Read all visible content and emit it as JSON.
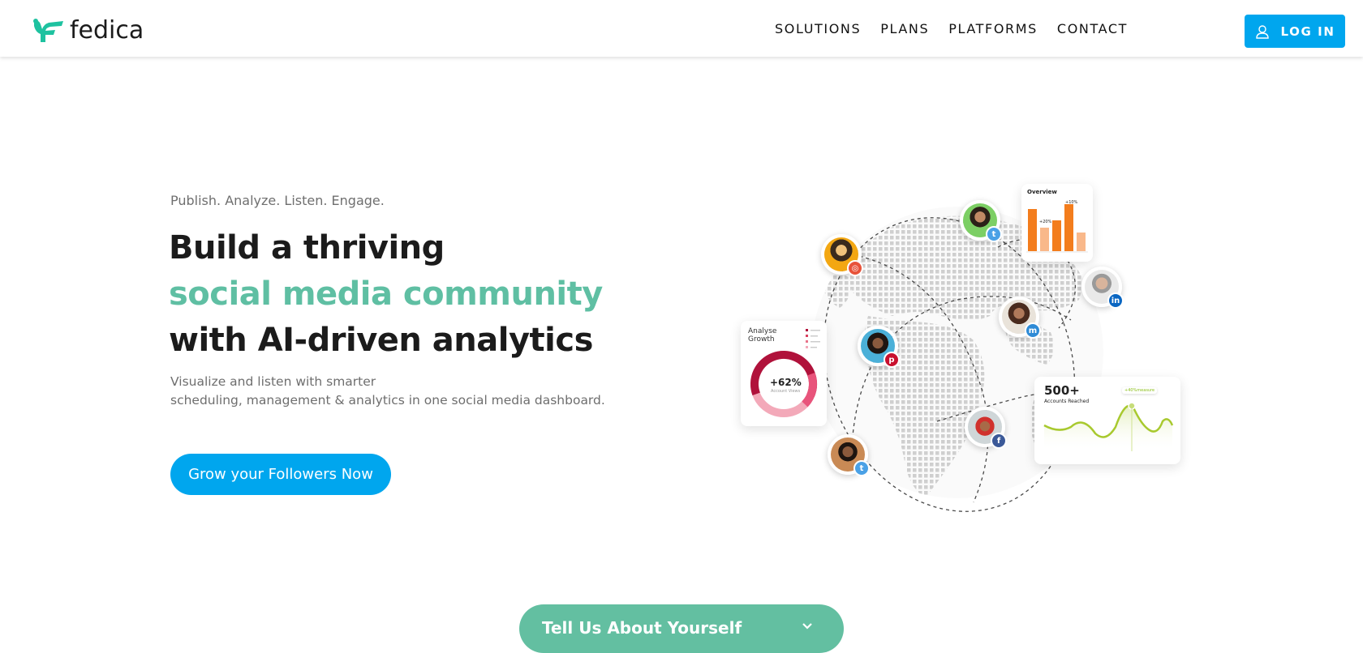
{
  "header": {
    "brand": "fedica",
    "nav": [
      "SOLUTIONS",
      "PLANS",
      "PLATFORMS",
      "CONTACT"
    ],
    "login_label": "LOG IN",
    "accent_color": "#00a6ee",
    "brand_color": "#1ec2a0"
  },
  "hero": {
    "eyebrow": "Publish. Analyze. Listen. Engage.",
    "headline_1": "Build a thriving",
    "headline_2": "social media community",
    "headline_3": "with AI-driven analytics",
    "sub_1": "Visualize and listen with smarter",
    "sub_2": "scheduling, management & analytics in one social media dashboard.",
    "cta": "Grow your Followers Now",
    "accent_color": "#5fbfa3"
  },
  "illustration": {
    "overview_title": "Overview",
    "overview_label_a": "+20%",
    "overview_label_b": "+10%",
    "analyse_title_1": "Analyse",
    "analyse_title_2": "Growth",
    "donut_value": "+62%",
    "donut_caption": "Account Views",
    "reach_value": "500+",
    "reach_caption": "Accounts Reached",
    "reach_tag": "+40%measure",
    "badges": [
      "instagram-icon",
      "twitter-icon",
      "linkedin-icon",
      "mastodon-icon",
      "pinterest-icon",
      "facebook-icon",
      "twitter-icon"
    ]
  },
  "tellus": {
    "label": "Tell Us About Yourself"
  }
}
